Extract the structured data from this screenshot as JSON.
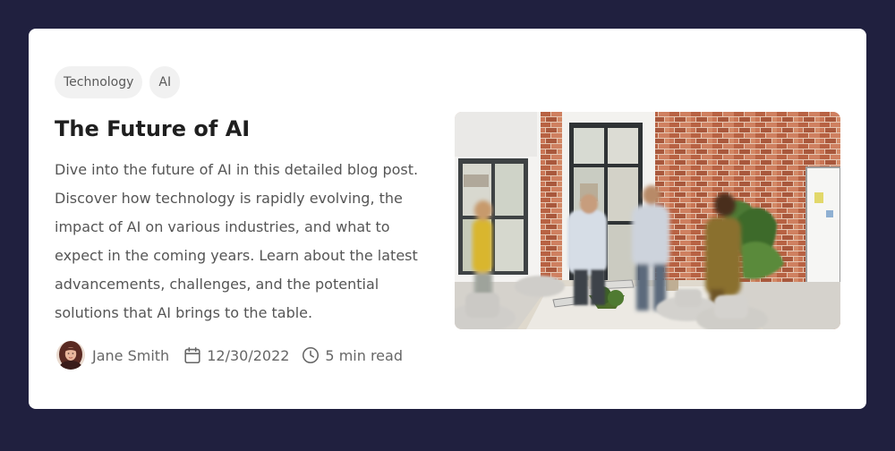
{
  "post": {
    "tags": [
      "Technology",
      "AI"
    ],
    "title": "The Future of AI",
    "description": "Dive into the future of AI in this detailed blog post. Discover how technology is rapidly evolving, the impact of AI on various industries, and what to expect in the coming years. Learn about the latest advancements, challenges, and the potential solutions that AI brings to the table.",
    "author": "Jane Smith",
    "date": "12/30/2022",
    "read_time": "5 min read"
  },
  "icons": {
    "date": "calendar-icon",
    "read_time": "clock-icon"
  },
  "colors": {
    "page_background": "#20203f",
    "card_background": "#ffffff",
    "tag_background": "#f1f1f1",
    "title_text": "#1f1f1f",
    "body_text": "#555555"
  }
}
